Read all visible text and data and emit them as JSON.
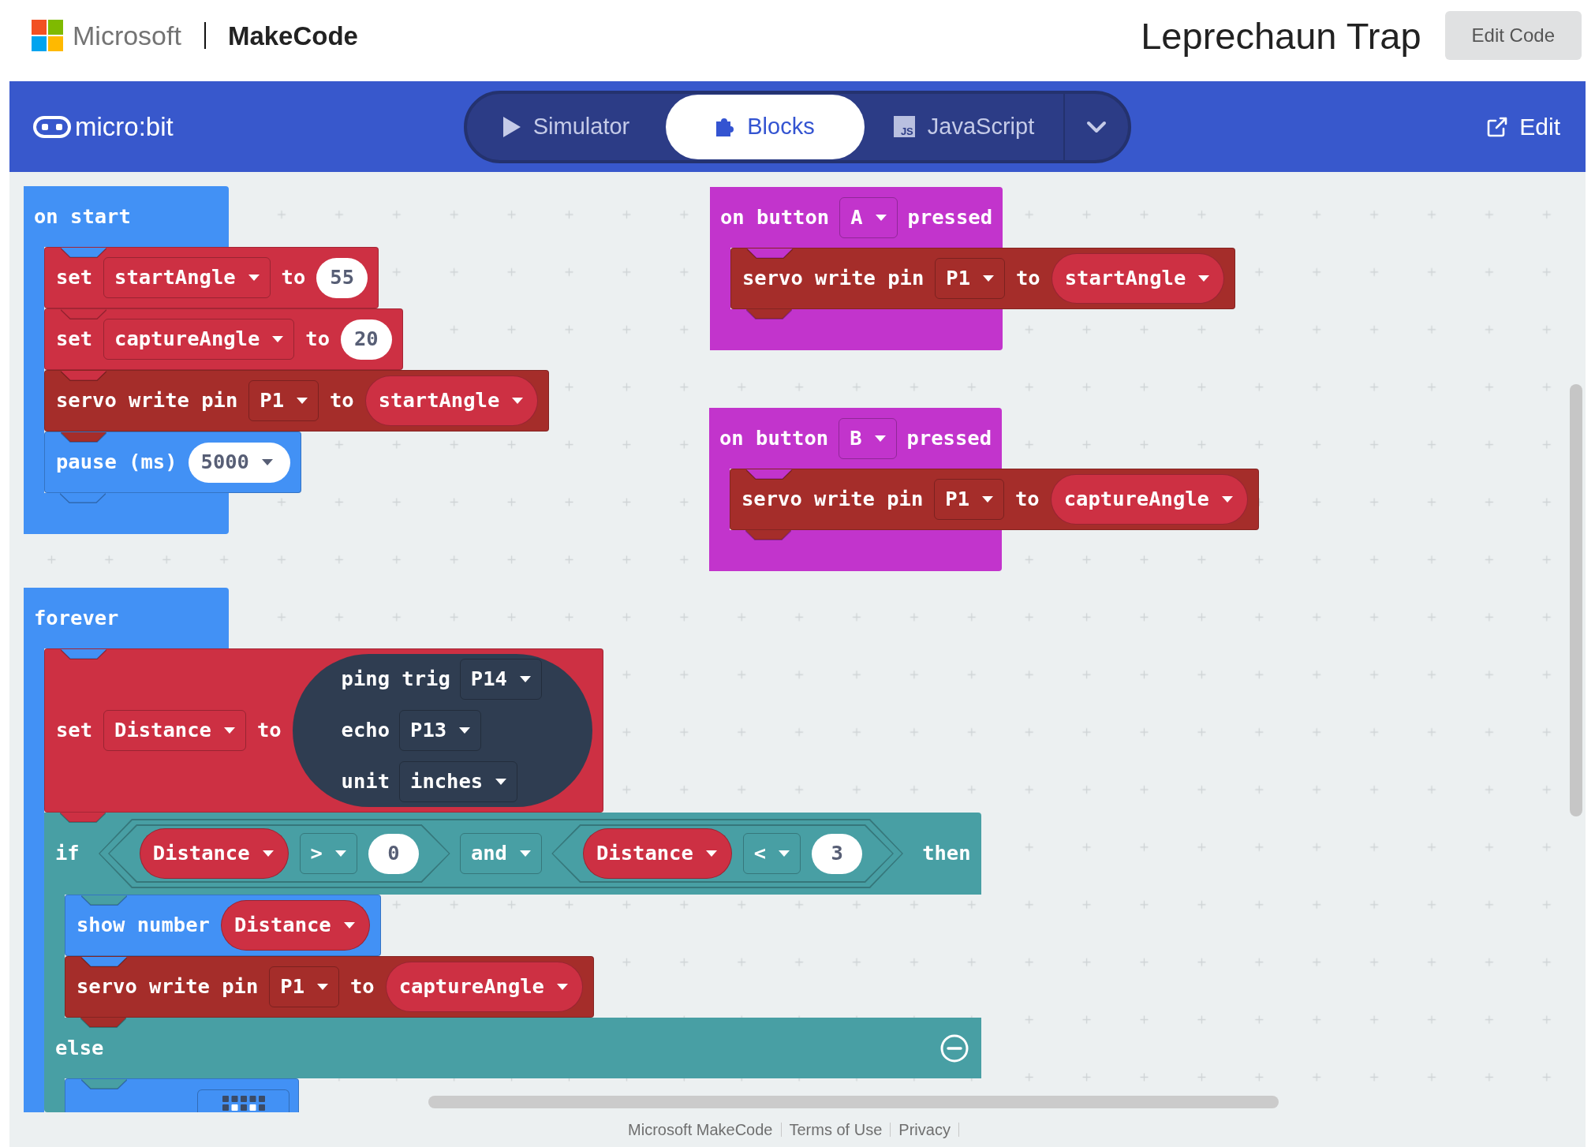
{
  "header": {
    "brand": "Microsoft",
    "product": "MakeCode",
    "project_title": "Leprechaun Trap",
    "edit_code_button": "Edit Code"
  },
  "toolbar": {
    "logo_text": "micro:bit",
    "views": [
      {
        "kind": "simulator",
        "label": "Simulator",
        "selected": false
      },
      {
        "kind": "blocks",
        "label": "Blocks",
        "selected": true
      },
      {
        "kind": "javascript",
        "label": "JavaScript",
        "icon_label": "JS",
        "selected": false
      }
    ],
    "edit_link": "Edit"
  },
  "workspace": {
    "scripts": [
      {
        "kind": "hat",
        "color": "#4291f5",
        "parts": [
          {
            "kind": "label",
            "text": "on start"
          }
        ],
        "body": [
          {
            "kind": "statement",
            "color": "#cd3043",
            "parts": [
              {
                "kind": "label",
                "text": "set"
              },
              {
                "kind": "dropdown",
                "text": "startAngle"
              },
              {
                "kind": "label",
                "text": "to"
              },
              {
                "kind": "number",
                "text": "55"
              }
            ]
          },
          {
            "kind": "statement",
            "color": "#cd3043",
            "parts": [
              {
                "kind": "label",
                "text": "set"
              },
              {
                "kind": "dropdown",
                "text": "captureAngle"
              },
              {
                "kind": "label",
                "text": "to"
              },
              {
                "kind": "number",
                "text": "20"
              }
            ]
          },
          {
            "kind": "statement",
            "color": "#a52d2a",
            "parts": [
              {
                "kind": "label",
                "text": "servo write pin"
              },
              {
                "kind": "dropdown",
                "text": "P1"
              },
              {
                "kind": "label",
                "text": "to"
              },
              {
                "kind": "variable",
                "color": "#cd3043",
                "text": "startAngle"
              }
            ]
          },
          {
            "kind": "statement",
            "color": "#4291f5",
            "parts": [
              {
                "kind": "label",
                "text": "pause (ms)"
              },
              {
                "kind": "number_dropdown",
                "text": "5000"
              }
            ]
          }
        ]
      },
      {
        "kind": "hat",
        "color": "#c234cc",
        "parts": [
          {
            "kind": "label",
            "text": "on button"
          },
          {
            "kind": "dropdown",
            "text": "A"
          },
          {
            "kind": "label",
            "text": "pressed"
          }
        ],
        "body": [
          {
            "kind": "statement",
            "color": "#a52d2a",
            "parts": [
              {
                "kind": "label",
                "text": "servo write pin"
              },
              {
                "kind": "dropdown",
                "text": "P1"
              },
              {
                "kind": "label",
                "text": "to"
              },
              {
                "kind": "variable",
                "color": "#cd3043",
                "text": "startAngle"
              }
            ]
          }
        ]
      },
      {
        "kind": "hat",
        "color": "#c234cc",
        "parts": [
          {
            "kind": "label",
            "text": "on button"
          },
          {
            "kind": "dropdown",
            "text": "B"
          },
          {
            "kind": "label",
            "text": "pressed"
          }
        ],
        "body": [
          {
            "kind": "statement",
            "color": "#a52d2a",
            "parts": [
              {
                "kind": "label",
                "text": "servo write pin"
              },
              {
                "kind": "dropdown",
                "text": "P1"
              },
              {
                "kind": "label",
                "text": "to"
              },
              {
                "kind": "variable",
                "color": "#cd3043",
                "text": "captureAngle"
              }
            ]
          }
        ]
      },
      {
        "kind": "hat",
        "color": "#4291f5",
        "parts": [
          {
            "kind": "label",
            "text": "forever"
          }
        ],
        "body": [
          {
            "kind": "statement",
            "color": "#cd3043",
            "parts": [
              {
                "kind": "label",
                "text": "set"
              },
              {
                "kind": "dropdown",
                "text": "Distance"
              },
              {
                "kind": "label",
                "text": "to"
              },
              {
                "kind": "reporter",
                "color": "#2f3d51",
                "rows": [
                  [
                    {
                      "kind": "label",
                      "text": "ping trig"
                    },
                    {
                      "kind": "dropdown",
                      "text": "P14"
                    }
                  ],
                  [
                    {
                      "kind": "label",
                      "text": "echo"
                    },
                    {
                      "kind": "dropdown",
                      "text": "P13"
                    }
                  ],
                  [
                    {
                      "kind": "label",
                      "text": "unit"
                    },
                    {
                      "kind": "dropdown",
                      "text": "inches"
                    }
                  ]
                ]
              }
            ]
          },
          {
            "kind": "if_else",
            "color": "#489fa4",
            "parts": [
              {
                "kind": "label",
                "text": "if"
              },
              {
                "kind": "boolean",
                "color": "#489fa4",
                "parts": [
                  {
                    "kind": "boolean",
                    "color": "#489fa4",
                    "parts": [
                      {
                        "kind": "variable",
                        "color": "#cd3043",
                        "text": "Distance"
                      },
                      {
                        "kind": "dropdown",
                        "text": ">"
                      },
                      {
                        "kind": "number",
                        "text": "0"
                      }
                    ]
                  },
                  {
                    "kind": "dropdown",
                    "text": "and"
                  },
                  {
                    "kind": "boolean",
                    "color": "#489fa4",
                    "parts": [
                      {
                        "kind": "variable",
                        "color": "#cd3043",
                        "text": "Distance"
                      },
                      {
                        "kind": "dropdown",
                        "text": "<"
                      },
                      {
                        "kind": "number",
                        "text": "3"
                      }
                    ]
                  }
                ]
              },
              {
                "kind": "label",
                "text": "then"
              }
            ],
            "body": [
              {
                "kind": "statement",
                "color": "#4291f5",
                "parts": [
                  {
                    "kind": "label",
                    "text": "show number"
                  },
                  {
                    "kind": "variable",
                    "color": "#cd3043",
                    "text": "Distance"
                  }
                ]
              },
              {
                "kind": "statement",
                "color": "#a52d2a",
                "parts": [
                  {
                    "kind": "label",
                    "text": "servo write pin"
                  },
                  {
                    "kind": "dropdown",
                    "text": "P1"
                  },
                  {
                    "kind": "label",
                    "text": "to"
                  },
                  {
                    "kind": "variable",
                    "color": "#cd3043",
                    "text": "captureAngle"
                  }
                ]
              }
            ],
            "else_parts": [
              {
                "kind": "label",
                "text": "else"
              },
              {
                "kind": "remove"
              }
            ],
            "else_body": [
              {
                "kind": "partial",
                "color": "#4291f5",
                "parts": [
                  {
                    "kind": "led_image"
                  }
                ]
              }
            ]
          }
        ]
      }
    ]
  },
  "footer": {
    "links": [
      "Microsoft MakeCode",
      "Terms of Use",
      "Privacy"
    ]
  }
}
